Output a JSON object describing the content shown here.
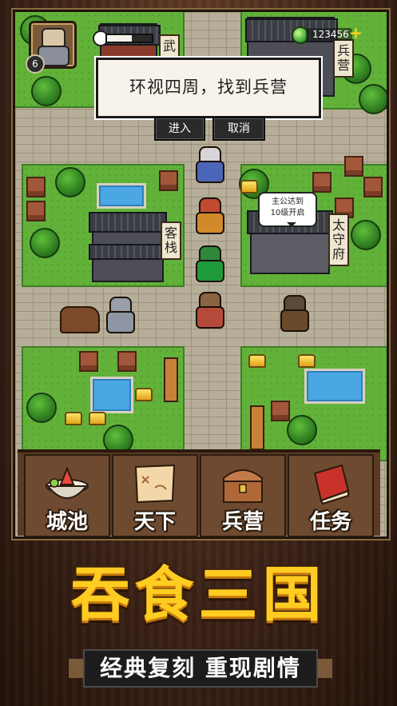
{
  "hud": {
    "level": "6",
    "currency": "123456",
    "plus": "+",
    "stamina_fraction": 0.55
  },
  "signs": {
    "wu": "武",
    "bingying": "兵营",
    "kezhan": "客栈",
    "taishoufu": "太守府"
  },
  "dialog": {
    "text": "环视四周，找到兵营",
    "enter": "进入",
    "cancel": "取消"
  },
  "bubble": {
    "line1": "主公达到",
    "line2": "10级开启"
  },
  "menu": [
    {
      "label": "城池",
      "icon": "bowl-icon"
    },
    {
      "label": "天下",
      "icon": "map-scroll-icon"
    },
    {
      "label": "兵营",
      "icon": "chest-icon"
    },
    {
      "label": "任务",
      "icon": "book-icon"
    }
  ],
  "title": "吞食三国",
  "subtitle": "经典复刻 重现剧情",
  "colors": {
    "grass": "#62b23a",
    "cobble": "#b7ae99",
    "title": "#ffcc22",
    "menu": "#6e4a31"
  }
}
